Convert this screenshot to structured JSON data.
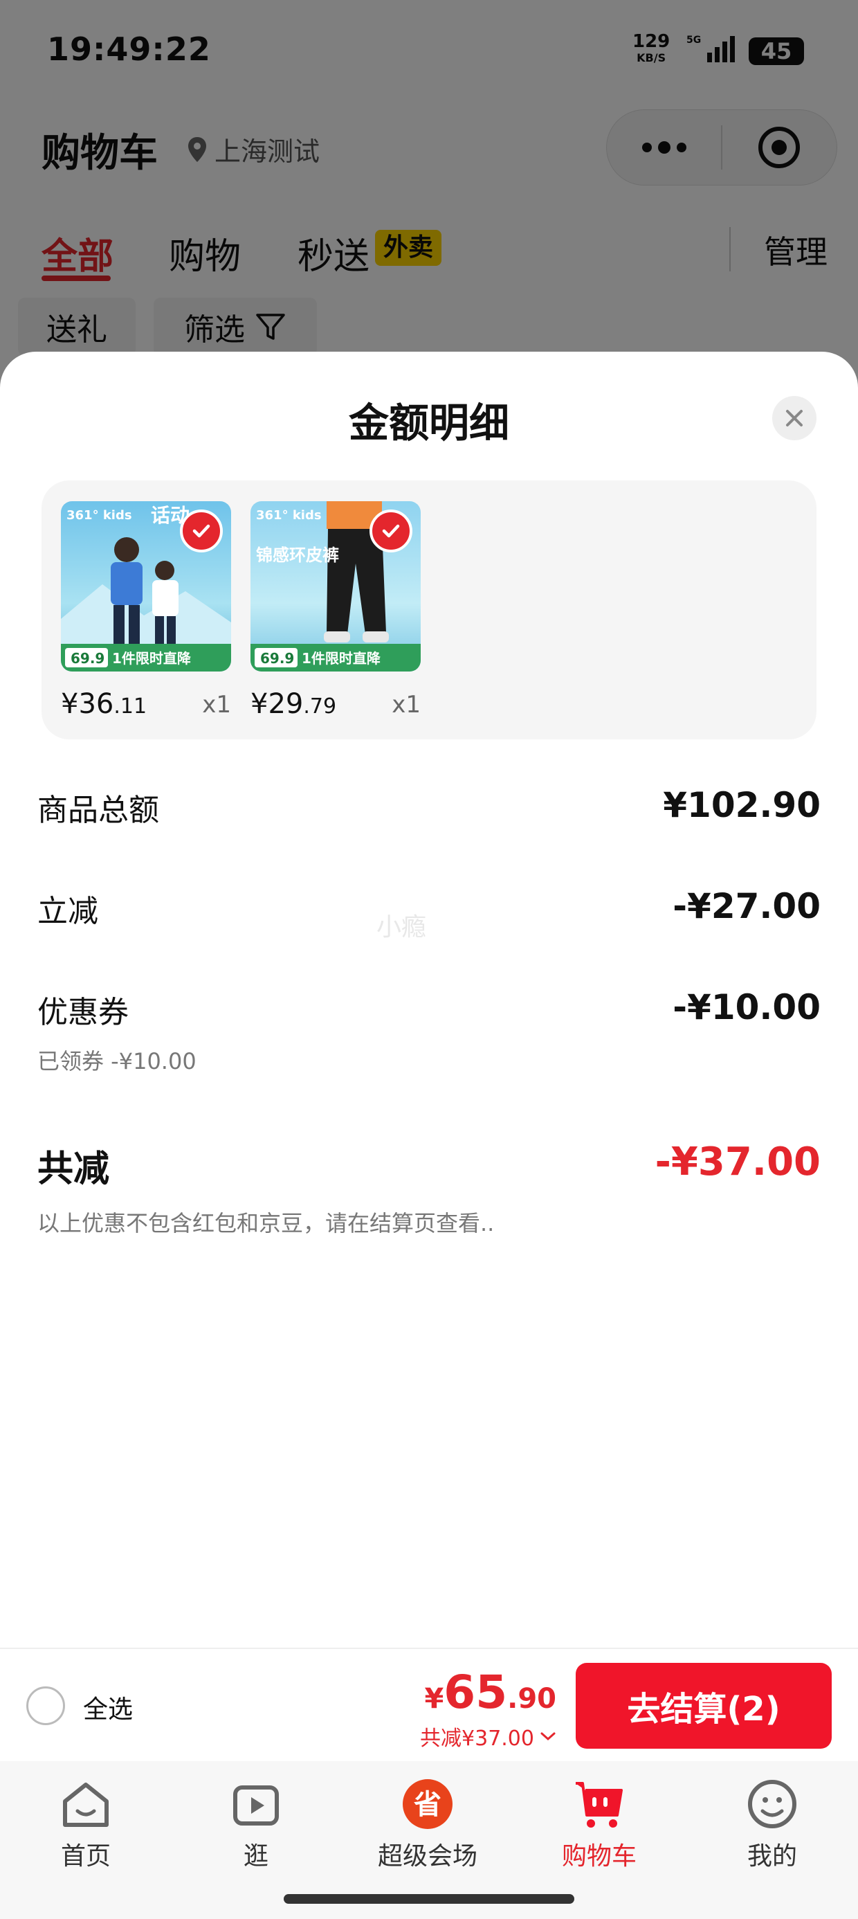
{
  "status_bar": {
    "time": "19:49:22",
    "net_speed": "129",
    "net_unit": "KB/S",
    "network": "5G",
    "battery": "45"
  },
  "header": {
    "title": "购物车",
    "location": "上海测试"
  },
  "tabs": [
    {
      "label": "全部"
    },
    {
      "label": "购物"
    },
    {
      "label": "秒送"
    }
  ],
  "tab_badge": "外卖",
  "manage_label": "管理",
  "chips": [
    {
      "label": "送礼"
    },
    {
      "label": "筛选"
    }
  ],
  "sheet": {
    "title": "金额明细",
    "products": [
      {
        "price_int": "¥36",
        "price_dec": ".11",
        "qty": "x1",
        "promo_price": "69.9",
        "promo_text": "1件限时直降",
        "brand": "361° kids",
        "headline": "话动"
      },
      {
        "price_int": "¥29",
        "price_dec": ".79",
        "qty": "x1",
        "promo_price": "69.9",
        "promo_text": "1件限时直降",
        "brand": "361° kids",
        "headline": "锦感环皮裤"
      }
    ],
    "rows": {
      "subtotal": {
        "label": "商品总额",
        "value": "¥102.90"
      },
      "instant": {
        "label": "立减",
        "value": "-¥27.00"
      },
      "coupon": {
        "label": "优惠券",
        "value": "-¥10.00",
        "sub": "已领券 -¥10.00"
      },
      "total": {
        "label": "共减",
        "value": "-¥37.00"
      }
    },
    "watermark": "小瘾",
    "note": "以上优惠不包含红包和京豆，请在结算页查看.."
  },
  "bottom_bar": {
    "select_all": "全选",
    "price_yen": "¥",
    "price_int": "65",
    "price_dec": ".90",
    "saving": "共减¥37.00",
    "checkout": "去结算(2)"
  },
  "nav": [
    {
      "label": "首页",
      "icon": "home-icon"
    },
    {
      "label": "逛",
      "icon": "video-icon"
    },
    {
      "label": "超级会场",
      "icon": "super-venue-icon"
    },
    {
      "label": "购物车",
      "icon": "cart-icon"
    },
    {
      "label": "我的",
      "icon": "profile-icon"
    }
  ],
  "colors": {
    "accent": "#e4262d",
    "checkout": "#f0152a",
    "badge": "#ffd400"
  }
}
